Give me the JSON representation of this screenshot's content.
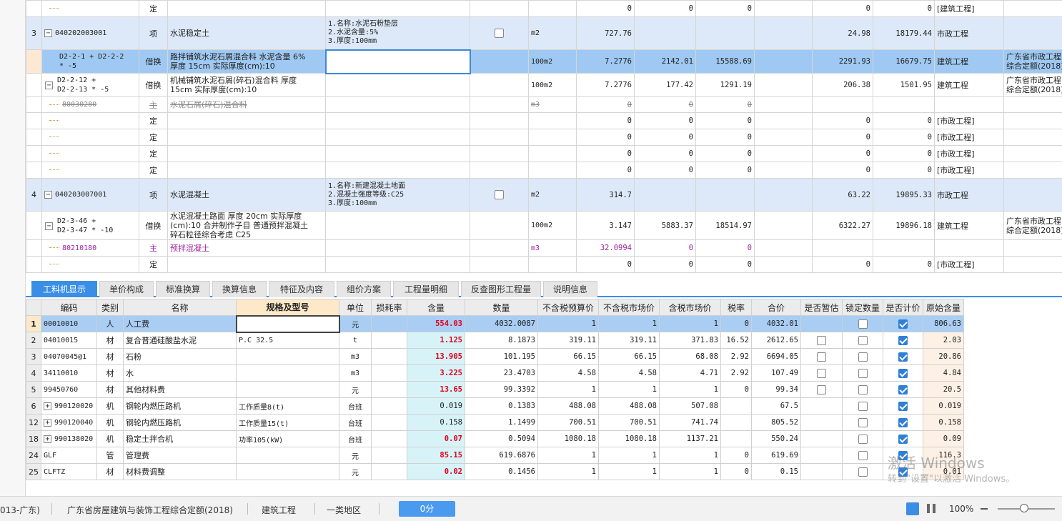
{
  "upper_rows": [
    {
      "kind": "sub",
      "no": "",
      "code": "",
      "type": "定",
      "name": "",
      "feature": "",
      "check": false,
      "unit": "",
      "qty": "0",
      "c1": "0",
      "c2": "0",
      "c3": "0",
      "c4": "0",
      "major": "[建筑工程]",
      "extra": ""
    },
    {
      "kind": "qd",
      "no": "3",
      "code": "040202003001",
      "type": "项",
      "name": "水泥稳定土",
      "feature": "1.名称:水泥石粉垫层\n2.水泥含量:5%\n3.厚度:100mm",
      "check": true,
      "unit": "m2",
      "qty": "727.76",
      "c1": "",
      "c2": "",
      "c3": "24.98",
      "c4": "18179.44",
      "major": "市政工程",
      "extra": ""
    },
    {
      "kind": "sel",
      "no": "",
      "code": "D2-2-1 + D2-2-2\n* -5",
      "type": "借换",
      "name": "路拌铺筑水泥石屑混合料 水泥含量 6%\n厚度 15cm  实际厚度(cm):10",
      "feature": "",
      "check": false,
      "unit": "100m2",
      "qty": "7.2776",
      "c1": "2142.01",
      "c2": "15588.69",
      "c3": "2291.93",
      "c4": "16679.75",
      "major": "建筑工程",
      "extra": "广东省市政工程\n综合定额(2018)"
    },
    {
      "kind": "de",
      "no": "",
      "code": "D2-2-12 +\nD2-2-13 * -5",
      "type": "借换",
      "name": "机械铺筑水泥石屑(碎石)混合料 厚度\n15cm  实际厚度(cm):10",
      "feature": "",
      "check": false,
      "unit": "100m2",
      "qty": "7.2776",
      "c1": "177.42",
      "c2": "1291.19",
      "c3": "206.38",
      "c4": "1501.95",
      "major": "建筑工程",
      "extra": "广东省市政工程\n综合定额(2018)"
    },
    {
      "kind": "strike",
      "no": "",
      "code": "80030280",
      "type": "主",
      "name": "水泥石屑(碎石)混合料",
      "feature": "",
      "check": false,
      "unit": "m3",
      "qty": "0",
      "c1": "0",
      "c2": "0",
      "c3": "",
      "c4": "",
      "major": "",
      "extra": ""
    },
    {
      "kind": "sub",
      "no": "",
      "code": "",
      "type": "定",
      "name": "",
      "feature": "",
      "check": false,
      "unit": "",
      "qty": "0",
      "c1": "0",
      "c2": "0",
      "c3": "0",
      "c4": "0",
      "major": "[市政工程]",
      "extra": ""
    },
    {
      "kind": "sub",
      "no": "",
      "code": "",
      "type": "定",
      "name": "",
      "feature": "",
      "check": false,
      "unit": "",
      "qty": "0",
      "c1": "0",
      "c2": "0",
      "c3": "0",
      "c4": "0",
      "major": "[市政工程]",
      "extra": ""
    },
    {
      "kind": "sub",
      "no": "",
      "code": "",
      "type": "定",
      "name": "",
      "feature": "",
      "check": false,
      "unit": "",
      "qty": "0",
      "c1": "0",
      "c2": "0",
      "c3": "0",
      "c4": "0",
      "major": "[市政工程]",
      "extra": ""
    },
    {
      "kind": "sub",
      "no": "",
      "code": "",
      "type": "定",
      "name": "",
      "feature": "",
      "check": false,
      "unit": "",
      "qty": "0",
      "c1": "0",
      "c2": "0",
      "c3": "0",
      "c4": "0",
      "major": "[市政工程]",
      "extra": ""
    },
    {
      "kind": "qd",
      "no": "4",
      "code": "040203007001",
      "type": "项",
      "name": "水泥混凝土",
      "feature": "1.名称:新建混凝土地面\n2.混凝土强度等级:C25\n3.厚度:100mm",
      "check": true,
      "unit": "m2",
      "qty": "314.7",
      "c1": "",
      "c2": "",
      "c3": "63.22",
      "c4": "19895.33",
      "major": "市政工程",
      "extra": ""
    },
    {
      "kind": "de",
      "no": "",
      "code": "D2-3-46 +\nD2-3-47 * -10",
      "type": "借换",
      "name": "水泥混凝土路面 厚度 20cm  实际厚度\n(cm):10  合并制作子目 普通预拌混凝土\n碎石粒径综合考虑 C25",
      "feature": "",
      "check": false,
      "unit": "100m2",
      "qty": "3.147",
      "c1": "5883.37",
      "c2": "18514.97",
      "c3": "6322.27",
      "c4": "19896.18",
      "major": "建筑工程",
      "extra": "广东省市政工程\n综合定额(2018)"
    },
    {
      "kind": "purple",
      "no": "",
      "code": "80210180",
      "type": "主",
      "name": "预拌混凝土",
      "feature": "",
      "check": false,
      "unit": "m3",
      "qty": "32.0994",
      "c1": "0",
      "c2": "0",
      "c3": "",
      "c4": "",
      "major": "",
      "extra": ""
    },
    {
      "kind": "sub",
      "no": "",
      "code": "",
      "type": "定",
      "name": "",
      "feature": "",
      "check": false,
      "unit": "",
      "qty": "0",
      "c1": "0",
      "c2": "0",
      "c3": "0",
      "c4": "0",
      "major": "[市政工程]",
      "extra": ""
    }
  ],
  "tabs": [
    "工料机显示",
    "单价构成",
    "标准换算",
    "换算信息",
    "特征及内容",
    "组价方案",
    "工程量明细",
    "反查图形工程量",
    "说明信息"
  ],
  "lower_headers": [
    "编码",
    "类别",
    "名称",
    "规格及型号",
    "单位",
    "损耗率",
    "含量",
    "数量",
    "不含税预算价",
    "不含税市场价",
    "含税市场价",
    "税率",
    "合价",
    "是否暂估",
    "锁定数量",
    "是否计价",
    "原始含量"
  ],
  "lower_rows": [
    {
      "no": "1",
      "expand": false,
      "code": "00010010",
      "cat": "人",
      "name": "人工费",
      "spec": "",
      "unit": "元",
      "loss": "",
      "content": "554.03",
      "red": true,
      "qty": "4032.0087",
      "p1": "1",
      "p2": "1",
      "p3": "1",
      "tax": "0",
      "total": "4032.01",
      "est": false,
      "lock": false,
      "price": true,
      "orig": "806.63"
    },
    {
      "no": "2",
      "expand": false,
      "code": "04010015",
      "cat": "材",
      "name": "复合普通硅酸盐水泥",
      "spec": "P.C 32.5",
      "unit": "t",
      "loss": "",
      "content": "1.125",
      "red": true,
      "qty": "8.1873",
      "p1": "319.11",
      "p2": "319.11",
      "p3": "371.83",
      "tax": "16.52",
      "total": "2612.65",
      "est": true,
      "lock": false,
      "price": true,
      "orig": "2.03"
    },
    {
      "no": "3",
      "expand": false,
      "code": "04070045@1",
      "cat": "材",
      "name": "石粉",
      "spec": "",
      "unit": "m3",
      "loss": "",
      "content": "13.905",
      "red": true,
      "qty": "101.195",
      "p1": "66.15",
      "p2": "66.15",
      "p3": "68.08",
      "tax": "2.92",
      "total": "6694.05",
      "est": true,
      "lock": false,
      "price": true,
      "orig": "20.86"
    },
    {
      "no": "4",
      "expand": false,
      "code": "34110010",
      "cat": "材",
      "name": "水",
      "spec": "",
      "unit": "m3",
      "loss": "",
      "content": "3.225",
      "red": true,
      "qty": "23.4703",
      "p1": "4.58",
      "p2": "4.58",
      "p3": "4.71",
      "tax": "2.92",
      "total": "107.49",
      "est": true,
      "lock": false,
      "price": true,
      "orig": "4.84"
    },
    {
      "no": "5",
      "expand": false,
      "code": "99450760",
      "cat": "材",
      "name": "其他材料费",
      "spec": "",
      "unit": "元",
      "loss": "",
      "content": "13.65",
      "red": true,
      "qty": "99.3392",
      "p1": "1",
      "p2": "1",
      "p3": "1",
      "tax": "0",
      "total": "99.34",
      "est": true,
      "lock": false,
      "price": true,
      "orig": "20.5"
    },
    {
      "no": "6",
      "expand": true,
      "code": "990120020",
      "cat": "机",
      "name": "钢轮内燃压路机",
      "spec": "工作质量8(t)",
      "unit": "台班",
      "loss": "",
      "content": "0.019",
      "red": false,
      "qty": "0.1383",
      "p1": "488.08",
      "p2": "488.08",
      "p3": "507.08",
      "tax": "",
      "total": "67.5",
      "est": false,
      "lock": false,
      "price": true,
      "orig": "0.019"
    },
    {
      "no": "12",
      "expand": true,
      "code": "990120040",
      "cat": "机",
      "name": "钢轮内燃压路机",
      "spec": "工作质量15(t)",
      "unit": "台班",
      "loss": "",
      "content": "0.158",
      "red": false,
      "qty": "1.1499",
      "p1": "700.51",
      "p2": "700.51",
      "p3": "741.74",
      "tax": "",
      "total": "805.52",
      "est": false,
      "lock": false,
      "price": true,
      "orig": "0.158"
    },
    {
      "no": "18",
      "expand": true,
      "code": "990138020",
      "cat": "机",
      "name": "稳定土拌合机",
      "spec": "功率105(kW)",
      "unit": "台班",
      "loss": "",
      "content": "0.07",
      "red": true,
      "qty": "0.5094",
      "p1": "1080.18",
      "p2": "1080.18",
      "p3": "1137.21",
      "tax": "",
      "total": "550.24",
      "est": false,
      "lock": false,
      "price": true,
      "orig": "0.09"
    },
    {
      "no": "24",
      "expand": false,
      "code": "GLF",
      "cat": "管",
      "name": "管理费",
      "spec": "",
      "unit": "元",
      "loss": "",
      "content": "85.15",
      "red": true,
      "qty": "619.6876",
      "p1": "1",
      "p2": "1",
      "p3": "1",
      "tax": "0",
      "total": "619.69",
      "est": false,
      "lock": false,
      "price": true,
      "orig": "116.3"
    },
    {
      "no": "25",
      "expand": false,
      "code": "CLFTZ",
      "cat": "材",
      "name": "材料费调整",
      "spec": "",
      "unit": "元",
      "loss": "",
      "content": "0.02",
      "red": true,
      "qty": "0.1456",
      "p1": "1",
      "p2": "1",
      "p3": "1",
      "tax": "0",
      "total": "0.15",
      "est": false,
      "lock": false,
      "price": true,
      "orig": "0.01"
    }
  ],
  "status": {
    "item1": "013-广东)",
    "item2": "广东省房屋建筑与装饰工程综合定额(2018)",
    "item3": "建筑工程",
    "item4": "一类地区",
    "score": "0分",
    "zoom": "100%"
  },
  "watermark": {
    "line1": "激活 Windows",
    "line2": "转到\"设置\"以激活 Windows。"
  }
}
